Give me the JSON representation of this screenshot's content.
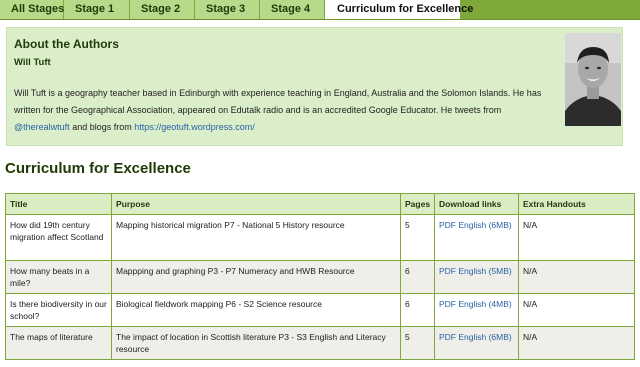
{
  "tabs": [
    {
      "label": "All Stages",
      "active": false
    },
    {
      "label": "Stage 1",
      "active": false
    },
    {
      "label": "Stage 2",
      "active": false
    },
    {
      "label": "Stage 3",
      "active": false
    },
    {
      "label": "Stage 4",
      "active": false
    },
    {
      "label": "Curriculum for Excellence",
      "active": true
    }
  ],
  "about": {
    "heading": "About the Authors",
    "author_name": "Will Tuft",
    "bio_text": "Will Tuft is a geography teacher based in Edinburgh with experience teaching in England, Australia and the Solomon Islands. He has written for the Geographical Association, appeared on Edutalk radio and is an accredited Google Educator. He tweets from",
    "twitter_handle": "@therealwtuft",
    "blog_intro": "and blogs from",
    "blog_url": "https://geotuft.wordpress.com/"
  },
  "section": {
    "title": "Curriculum for Excellence"
  },
  "table": {
    "headers": {
      "title": "Title",
      "purpose": "Purpose",
      "pages": "Pages",
      "download": "Download links",
      "extra": "Extra Handouts"
    },
    "rows": [
      {
        "title": "How did 19th century migration affect Scotland",
        "purpose": "Mapping historical migration P7 - National 5 History resource",
        "pages": "5",
        "download": "PDF English (6MB)",
        "extra": "N/A"
      },
      {
        "title": "How many beats in a mile?",
        "purpose": "Mappping and graphing P3 - P7 Numeracy and HWB Resource",
        "pages": "6",
        "download": "PDF English (5MB)",
        "extra": "N/A"
      },
      {
        "title": "Is there biodiversity in our school?",
        "purpose": "Biological fieldwork mapping P6 - S2 Science resource",
        "pages": "6",
        "download": "PDF English (4MB)",
        "extra": "N/A"
      },
      {
        "title": "The maps of literature",
        "purpose": "The impact of location in Scottish literature P3 - S3 English and Literacy resource",
        "pages": "5",
        "download": "PDF English (6MB)",
        "extra": "N/A"
      }
    ]
  }
}
